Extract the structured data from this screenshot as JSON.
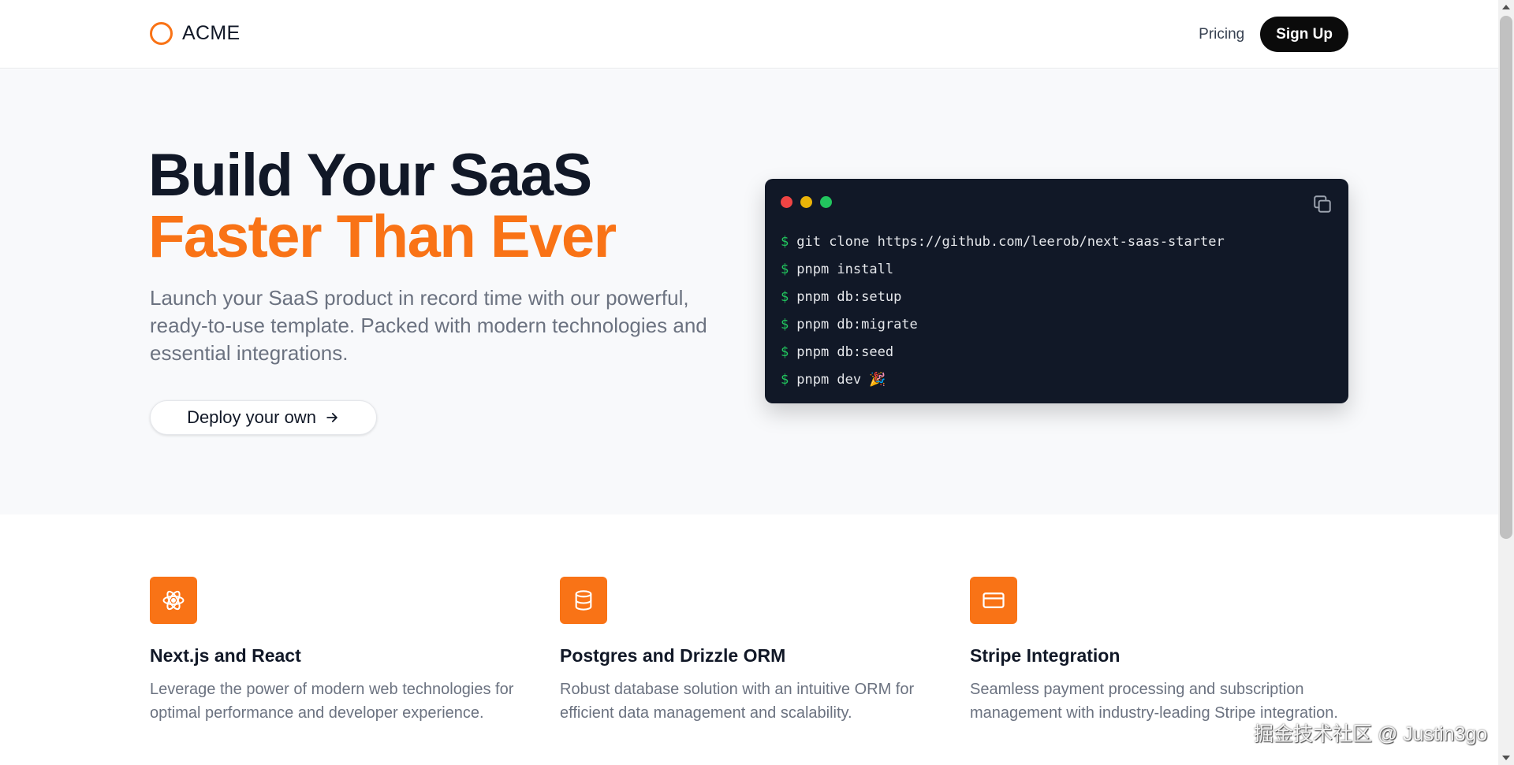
{
  "header": {
    "logo_text": "ACME",
    "nav": {
      "pricing": "Pricing",
      "signup": "Sign Up"
    }
  },
  "hero": {
    "title_line1": "Build Your SaaS",
    "title_line2": "Faster Than Ever",
    "description": "Launch your SaaS product in record time with our powerful, ready-to-use template. Packed with modern technologies and essential integrations.",
    "cta_label": "Deploy your own",
    "cta_icon": "arrow-right-icon"
  },
  "terminal": {
    "prompt": "$",
    "commands": [
      "git clone https://github.com/leerob/next-saas-starter",
      "pnpm install",
      "pnpm db:setup",
      "pnpm db:migrate",
      "pnpm db:seed",
      "pnpm dev 🎉"
    ],
    "copy_icon": "copy-icon"
  },
  "features": [
    {
      "icon": "react-atom-icon",
      "title": "Next.js and React",
      "description": "Leverage the power of modern web technologies for optimal performance and developer experience."
    },
    {
      "icon": "database-icon",
      "title": "Postgres and Drizzle ORM",
      "description": "Robust database solution with an intuitive ORM for efficient data management and scalability."
    },
    {
      "icon": "credit-card-icon",
      "title": "Stripe Integration",
      "description": "Seamless payment processing and subscription management with industry-leading Stripe integration."
    }
  ],
  "watermark": "掘金技术社区 @ Justin3go",
  "colors": {
    "accent": "#f97316",
    "terminal_bg": "#111827",
    "prompt_green": "#22c55e",
    "text_dark": "#111827",
    "text_muted": "#6b7280"
  }
}
